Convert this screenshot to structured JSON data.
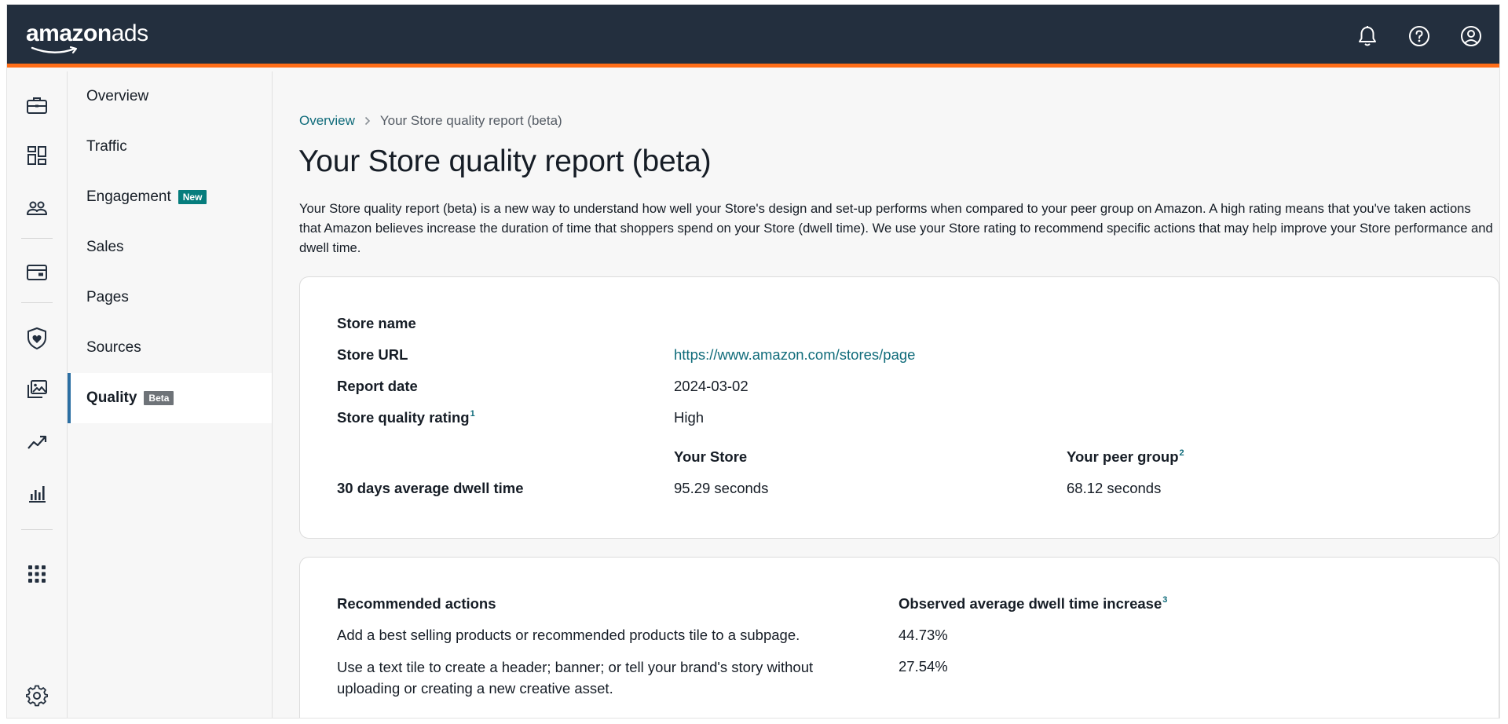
{
  "header": {
    "logo_bold": "amazon",
    "logo_regular": "ads",
    "icons": [
      "bell-icon",
      "help-icon",
      "account-icon"
    ]
  },
  "rail": {
    "icons": [
      "briefcase-icon",
      "dashboard-icon",
      "people-icon",
      "wallet-icon",
      "shield-icon",
      "media-library-icon",
      "trend-icon",
      "bar-chart-icon",
      "apps-grid-icon",
      "gear-icon"
    ]
  },
  "nav": {
    "items": [
      {
        "label": "Overview"
      },
      {
        "label": "Traffic"
      },
      {
        "label": "Engagement",
        "badge": "New"
      },
      {
        "label": "Sales"
      },
      {
        "label": "Pages"
      },
      {
        "label": "Sources"
      },
      {
        "label": "Quality",
        "badge": "Beta",
        "active": true
      }
    ]
  },
  "breadcrumb": {
    "parent": "Overview",
    "current": "Your Store quality report (beta)"
  },
  "page": {
    "title": "Your Store quality report (beta)",
    "description": "Your Store quality report (beta) is a new way to understand how well your Store's design and set-up performs when compared to your peer group on Amazon. A high rating means that you've taken actions that Amazon believes increase the duration of time that shoppers spend on your Store (dwell time). We use your Store rating to recommend specific actions that may help improve your Store performance and dwell time."
  },
  "summary": {
    "store_name_label": "Store name",
    "store_name_value": "",
    "store_url_label": "Store URL",
    "store_url_value": "https://www.amazon.com/stores/page",
    "report_date_label": "Report date",
    "report_date_value": "2024-03-02",
    "rating_label": "Store quality rating",
    "rating_footnote": "1",
    "rating_value": "High",
    "your_store_header": "Your Store",
    "peer_group_header": "Your peer group",
    "peer_group_footnote": "2",
    "dwell_label": "30 days average dwell time",
    "dwell_your_store": "95.29 seconds",
    "dwell_peer_group": "68.12 seconds"
  },
  "recommendations": {
    "actions_header": "Recommended actions",
    "increase_header": "Observed average dwell time increase",
    "increase_footnote": "3",
    "rows": [
      {
        "action": "Add a best selling products or recommended products tile to a subpage.",
        "increase": "44.73%"
      },
      {
        "action": "Use a text tile to create a header; banner; or tell your brand's story without uploading or creating a new creative asset.",
        "increase": "27.54%"
      }
    ]
  },
  "colors": {
    "topbar": "#232f3e",
    "accent_stripe": "#ff6d17",
    "link": "#0f6b7a",
    "badge_new": "#067d7d",
    "badge_beta": "#6e7378",
    "active_indicator": "#2c6fa3"
  }
}
